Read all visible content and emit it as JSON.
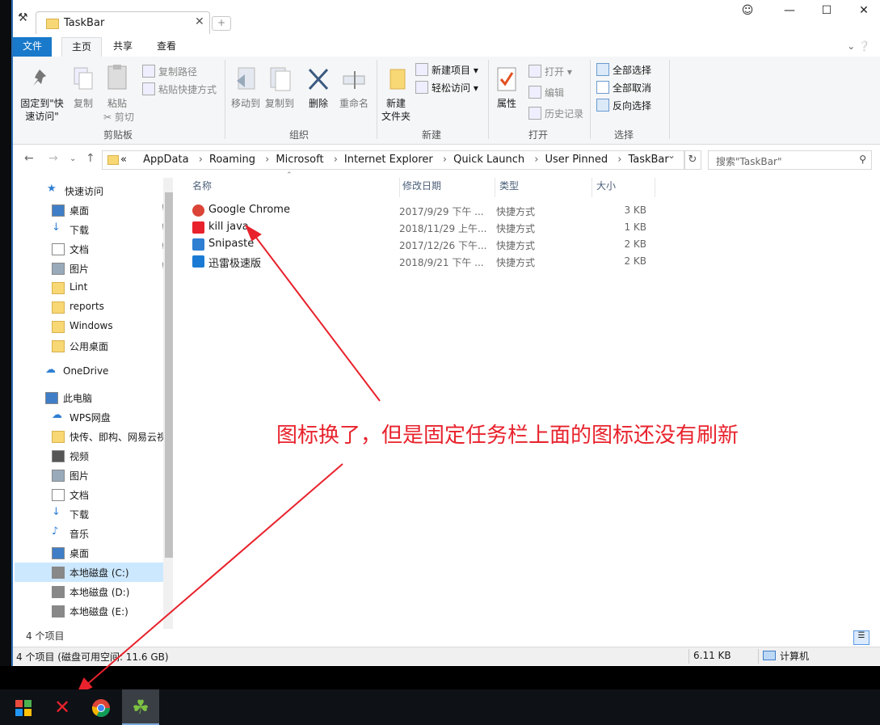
{
  "window": {
    "tab_title": "TaskBar",
    "buttons": {
      "user": "♂",
      "minimize": "—",
      "maximize": "☐",
      "close": "✕"
    }
  },
  "ribbon": {
    "tabs": [
      "文件",
      "主页",
      "共享",
      "查看"
    ],
    "groups": {
      "clipboard": {
        "label": "剪贴板",
        "pin": "固定到\"快速访问\"",
        "copy": "复制",
        "paste": "粘贴",
        "copy_path": "复制路径",
        "paste_shortcut": "粘贴快捷方式",
        "cut": "剪切"
      },
      "organize": {
        "label": "组织",
        "move_to": "移动到",
        "copy_to": "复制到",
        "delete": "删除",
        "rename": "重命名"
      },
      "new": {
        "label": "新建",
        "new_folder": "新建\n文件夹",
        "new_item": "新建项目",
        "easy_access": "轻松访问"
      },
      "open": {
        "label": "打开",
        "properties": "属性",
        "open": "打开",
        "edit": "编辑",
        "history": "历史记录"
      },
      "select": {
        "label": "选择",
        "select_all": "全部选择",
        "select_none": "全部取消",
        "invert": "反向选择"
      }
    }
  },
  "address": {
    "prefix": "«",
    "crumbs": [
      "AppData",
      "Roaming",
      "Microsoft",
      "Internet Explorer",
      "Quick Launch",
      "User Pinned",
      "TaskBar"
    ],
    "search_placeholder": "搜索\"TaskBar\""
  },
  "nav": {
    "items": [
      {
        "label": "快速访问",
        "icon": "star-icon",
        "pinned": false
      },
      {
        "label": "桌面",
        "icon": "desktop-icon",
        "pinned": true
      },
      {
        "label": "下载",
        "icon": "download-icon",
        "pinned": true
      },
      {
        "label": "文档",
        "icon": "document-icon",
        "pinned": true
      },
      {
        "label": "图片",
        "icon": "picture-icon",
        "pinned": true
      },
      {
        "label": "Lint",
        "icon": "folder-icon",
        "pinned": false
      },
      {
        "label": "reports",
        "icon": "folder-icon",
        "pinned": false
      },
      {
        "label": "Windows",
        "icon": "folder-icon",
        "pinned": false
      },
      {
        "label": "公用桌面",
        "icon": "folder-icon",
        "pinned": false
      },
      {
        "label": "OneDrive",
        "icon": "cloud-icon",
        "pinned": false
      },
      {
        "label": "此电脑",
        "icon": "computer-icon",
        "pinned": false
      },
      {
        "label": "WPS网盘",
        "icon": "cloud-icon",
        "pinned": false
      },
      {
        "label": "快传、即构、网易云视频",
        "icon": "folder-icon",
        "pinned": false
      },
      {
        "label": "视频",
        "icon": "video-icon",
        "pinned": false
      },
      {
        "label": "图片",
        "icon": "picture-icon",
        "pinned": false
      },
      {
        "label": "文档",
        "icon": "document-icon",
        "pinned": false
      },
      {
        "label": "下载",
        "icon": "download-icon",
        "pinned": false
      },
      {
        "label": "音乐",
        "icon": "music-icon",
        "pinned": false
      },
      {
        "label": "桌面",
        "icon": "desktop-icon",
        "pinned": false
      },
      {
        "label": "本地磁盘 (C:)",
        "icon": "drive-icon",
        "pinned": false
      },
      {
        "label": "本地磁盘 (D:)",
        "icon": "drive-icon",
        "pinned": false
      },
      {
        "label": "本地磁盘 (E:)",
        "icon": "drive-icon",
        "pinned": false
      }
    ]
  },
  "list": {
    "columns": [
      "名称",
      "修改日期",
      "类型",
      "大小"
    ],
    "rows": [
      {
        "name": "Google Chrome",
        "date": "2017/9/29 下午 ...",
        "type": "快捷方式",
        "size": "3 KB",
        "icon": "chrome-icon"
      },
      {
        "name": "kill java",
        "date": "2018/11/29 上午...",
        "type": "快捷方式",
        "size": "1 KB",
        "icon": "kill-java-icon"
      },
      {
        "name": "Snipaste",
        "date": "2017/12/26 下午...",
        "type": "快捷方式",
        "size": "2 KB",
        "icon": "snipaste-icon"
      },
      {
        "name": "迅雷极速版",
        "date": "2018/9/21 下午 ...",
        "type": "快捷方式",
        "size": "2 KB",
        "icon": "xunlei-icon"
      }
    ]
  },
  "annotation": "图标换了，但是固定任务栏上面的图标还没有刷新",
  "item_count": "4 个项目",
  "status": {
    "left": "4 个项目 (磁盘可用空间: 11.6 GB)",
    "size": "6.11 KB",
    "location": "计算机"
  },
  "taskbar": {
    "items": [
      "app-launcher-icon",
      "kill-java-icon",
      "chrome-icon",
      "clover-icon"
    ]
  },
  "colors": {
    "accent": "#1979ca",
    "annotation": "#e8222c",
    "selection": "#cce8ff"
  }
}
